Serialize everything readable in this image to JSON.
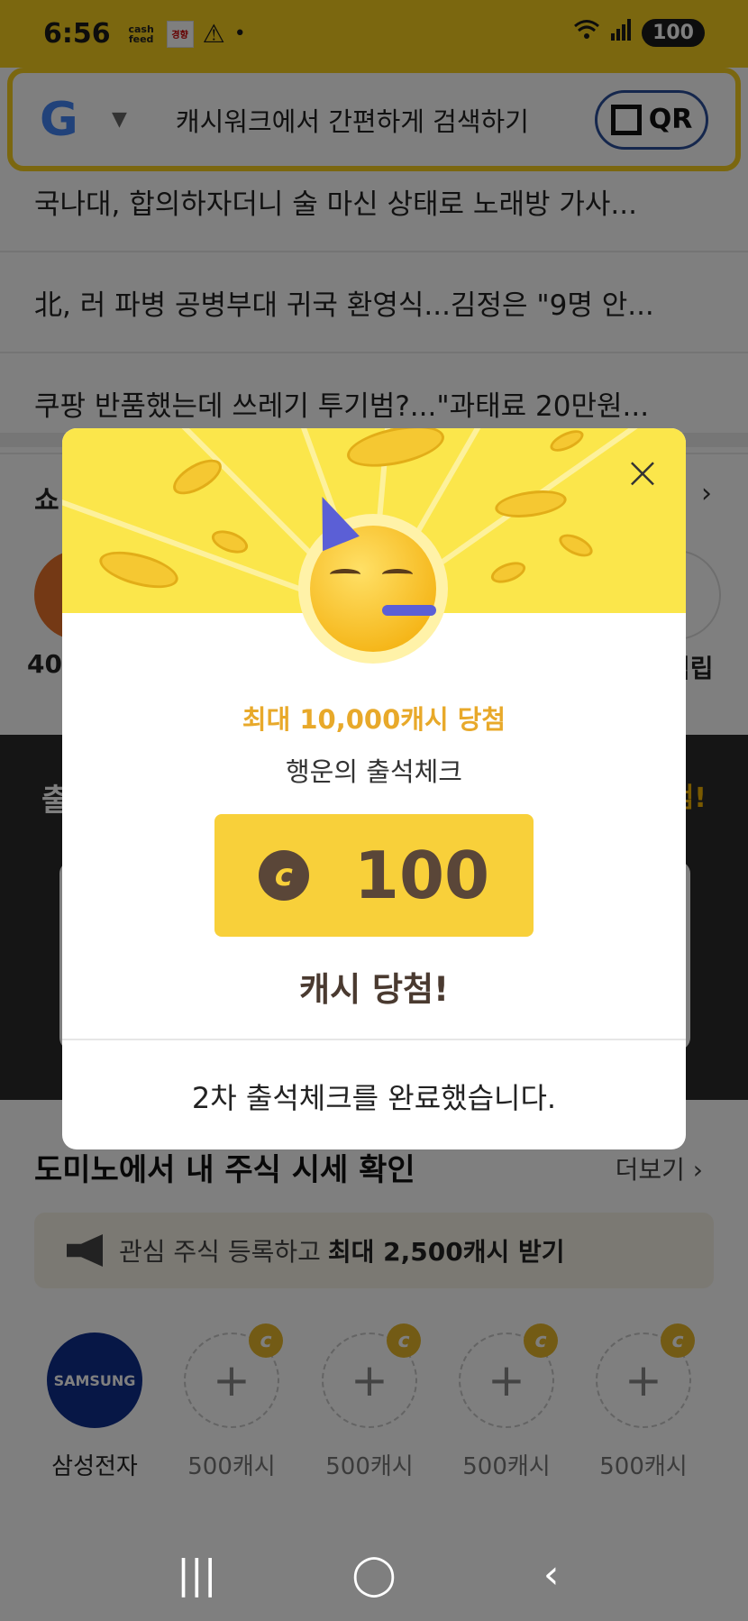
{
  "status_bar": {
    "time": "6:56",
    "notif_app": "cash feed",
    "notif_news": "경향",
    "network": "5",
    "battery": "100"
  },
  "search": {
    "engine": "G",
    "placeholder": "캐시워크에서 간편하게 검색하기",
    "qr_label": "QR"
  },
  "news": [
    "국나대, 합의하자더니 술 마신 상태로 노래방 가사...",
    "北, 러 파병 공병부대 귀국 환영식...김정은 \"9명 안...",
    "쿠팡 반품했는데 쓰레기 투기범?...\"과태료 20만원..."
  ],
  "shopping": {
    "title": "쇼",
    "more": "›",
    "left_label": "40%",
    "right_label": "적립"
  },
  "attendance_banner": {
    "title": "출",
    "hot": "첨!"
  },
  "domino": {
    "title": "도미노에서 내 주식 시세 확인",
    "more": "더보기 ›",
    "promo_text": "관심 주식 등록하고",
    "promo_bold": "최대 2,500캐시 받기",
    "stocks": [
      {
        "name": "삼성전자",
        "logo": "SAMSUNG"
      },
      {
        "name": "500캐시"
      },
      {
        "name": "500캐시"
      },
      {
        "name": "500캐시"
      },
      {
        "name": "500캐시"
      }
    ],
    "coin_symbol": "c"
  },
  "modal": {
    "max_text": "최대 10,000캐시 당첨",
    "sub_text": "행운의 출석체크",
    "coin_symbol": "c",
    "amount": "100",
    "result": "캐시 당첨!",
    "done": "2차 출석체크를 완료했습니다.",
    "close": "×"
  },
  "navbar": {
    "recent": "|||",
    "home": "◯",
    "back": "‹"
  },
  "colors": {
    "brand_yellow": "#f7cf1e",
    "reward_yellow": "#f8d03a",
    "accent_orange": "#e8a92a",
    "coin_brown": "#5a4638"
  }
}
